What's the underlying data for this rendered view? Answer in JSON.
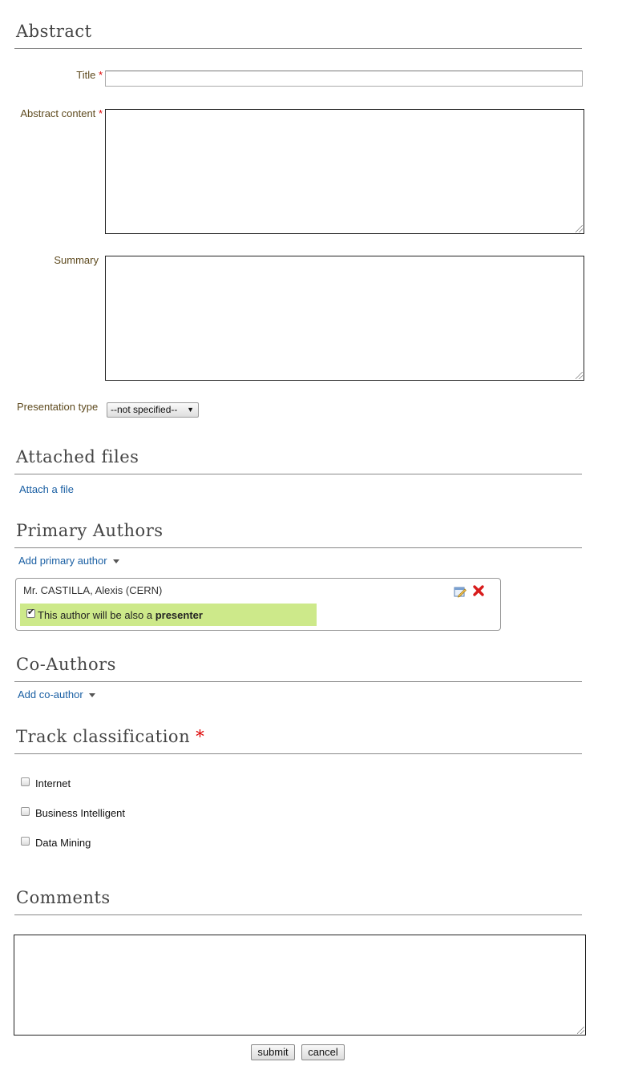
{
  "abstract_section": {
    "heading": "Abstract",
    "title_label": "Title",
    "title_value": "",
    "content_label": "Abstract content",
    "content_value": "",
    "summary_label": "Summary",
    "summary_value": "",
    "required_mark": "*",
    "presentation_type_label": "Presentation type",
    "presentation_type_value": "--not specified--"
  },
  "attached_files": {
    "heading": "Attached files",
    "attach_link": "Attach a file"
  },
  "primary_authors": {
    "heading": "Primary Authors",
    "add_link": "Add primary author",
    "authors": [
      {
        "name": "Mr. CASTILLA, Alexis (CERN)",
        "presenter_text": "This author will be also a ",
        "presenter_bold": "presenter",
        "presenter_checked": true
      }
    ]
  },
  "co_authors": {
    "heading": "Co-Authors",
    "add_link": "Add co-author"
  },
  "track_classification": {
    "heading": "Track classification",
    "required_mark": "*",
    "tracks": [
      {
        "label": "Internet",
        "checked": false
      },
      {
        "label": "Business Intelligent",
        "checked": false
      },
      {
        "label": "Data Mining",
        "checked": false
      }
    ]
  },
  "comments": {
    "heading": "Comments",
    "value": ""
  },
  "actions": {
    "submit_label": "submit",
    "cancel_label": "cancel"
  },
  "colors": {
    "label_text": "#5e4a1e",
    "link": "#1a5fa3",
    "required": "#dd0000",
    "presenter_highlight": "#cde98a"
  },
  "icons": {
    "author_edit": "edit-pencil-icon",
    "author_remove": "red-x-remove-icon",
    "dropdown_caret": "caret-down-icon"
  }
}
